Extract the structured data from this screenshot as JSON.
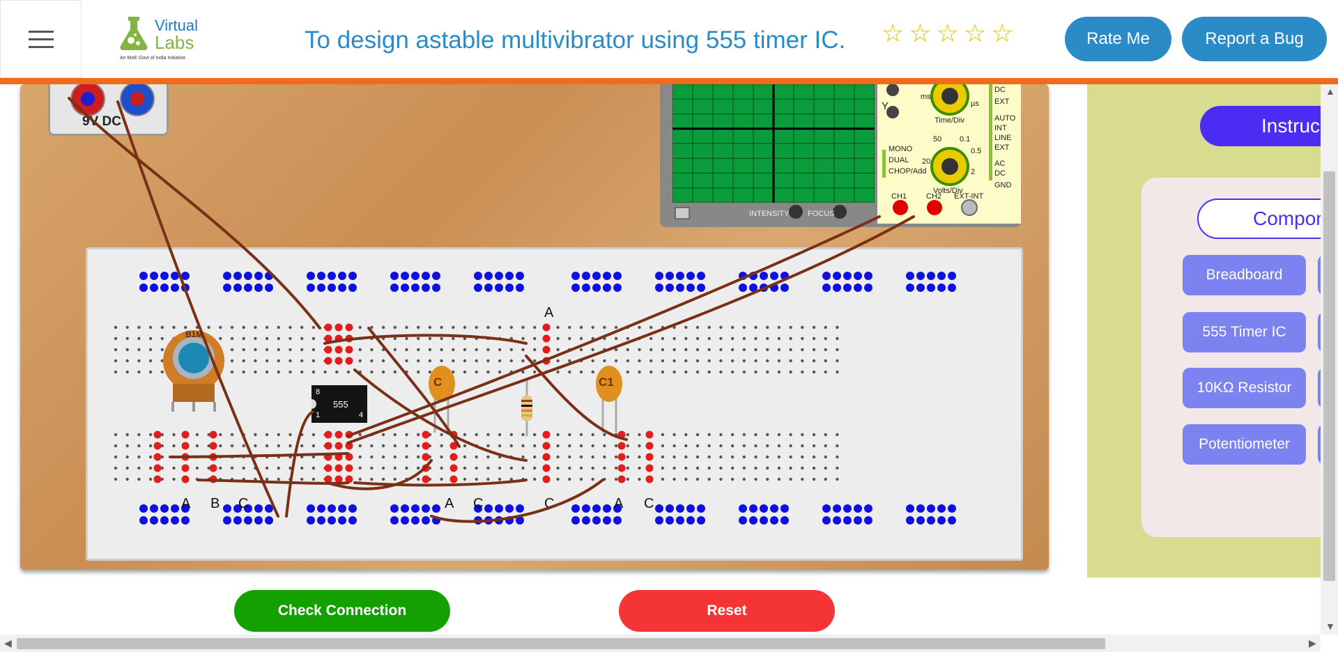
{
  "header": {
    "menu_icon": "hamburger-menu-icon",
    "logo": {
      "line1": "Virtual",
      "line2": "Labs",
      "tagline": "An MoE Govt of India Initiative"
    },
    "title": "To design astable multivibrator using 555 timer IC.",
    "rating": {
      "stars_total": 5,
      "stars_filled": 0
    },
    "rate_button": "Rate Me",
    "bug_button": "Report a Bug"
  },
  "workbench": {
    "power_supply": {
      "label": "9V  DC"
    },
    "oscilloscope": {
      "labels": [
        "DC",
        "EXT",
        "AUTO",
        "INT",
        "LINE",
        "EXT",
        "AC",
        "DC",
        "GND",
        "ms",
        "µs",
        "Time/Div",
        "Volts/Div",
        "MONO",
        "DUAL",
        "CHOP/Add",
        "CH1",
        "CH2",
        "EXT-INT",
        "INTENSITY",
        "FOCUS",
        "Y",
        "50",
        "0.1",
        "20",
        "0.5",
        "2"
      ]
    },
    "breadboard": {
      "pin_labels": [
        {
          "text": "A"
        },
        {
          "text": "B"
        },
        {
          "text": "C"
        },
        {
          "text": "A"
        },
        {
          "text": "C"
        },
        {
          "text": "C"
        },
        {
          "text": "A"
        },
        {
          "text": "C"
        },
        {
          "text": "A"
        }
      ],
      "components": {
        "pot": "B1M",
        "ic": "555",
        "ic_pin8": "8",
        "ic_pin1": "1",
        "ic_pin4": "4",
        "cap1": "C",
        "cap2": "C1"
      }
    }
  },
  "actions": {
    "check": "Check Connection",
    "reset": "Reset"
  },
  "sidebar": {
    "instructions_label": "Instruc",
    "components_label": "Compon",
    "components": [
      "Breadboard",
      "555 Timer IC",
      "10KΩ Resistor",
      "Potentiometer"
    ]
  },
  "colors": {
    "brand_blue": "#2a8bc7",
    "orange": "#f26a1b",
    "green": "#14a000",
    "red": "#f53535",
    "purple": "#4b2cf3",
    "wire": "#7a2f17"
  }
}
